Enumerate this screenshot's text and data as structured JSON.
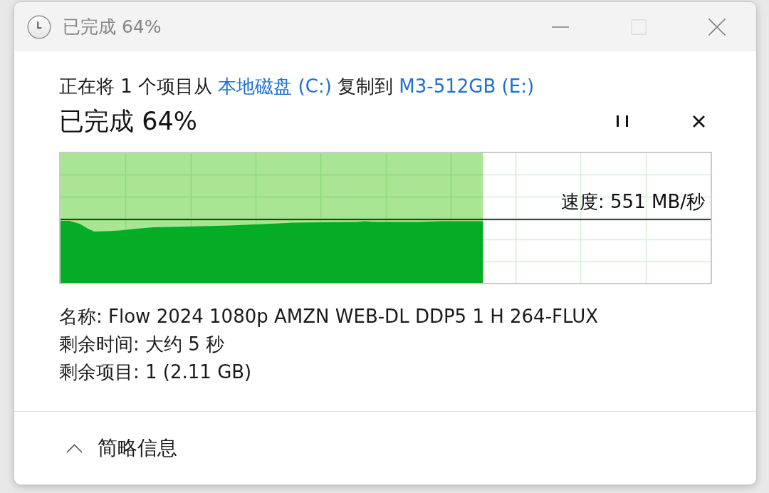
{
  "window": {
    "title": "已完成 64%",
    "buttons": [
      {
        "kind": "minimize",
        "disabled": false
      },
      {
        "kind": "maximize",
        "disabled": true
      },
      {
        "kind": "close",
        "disabled": false
      }
    ]
  },
  "copy": {
    "description": [
      {
        "kind": "text",
        "text": "正在将 1 个项目从"
      },
      {
        "kind": "link",
        "text": "本地磁盘 (C:)"
      },
      {
        "kind": "text",
        "text": "复制到"
      },
      {
        "kind": "link",
        "text": "M3-512GB (E:)"
      }
    ],
    "title": "已完成 64%",
    "controls": [
      {
        "kind": "pause"
      },
      {
        "kind": "cancel"
      }
    ]
  },
  "progress": {
    "level": 0.65,
    "speed": "速度: 551 MB/秒"
  },
  "details": [
    "名称: Flow 2024 1080p AMZN WEB-DL DDP5 1 H 264-FLUX",
    "剩余时间: 大约 5 秒",
    "剩余项目: 1 (2.11 GB)"
  ],
  "footer": {
    "toggle": {
      "label": "简略信息",
      "expanded": true
    }
  }
}
